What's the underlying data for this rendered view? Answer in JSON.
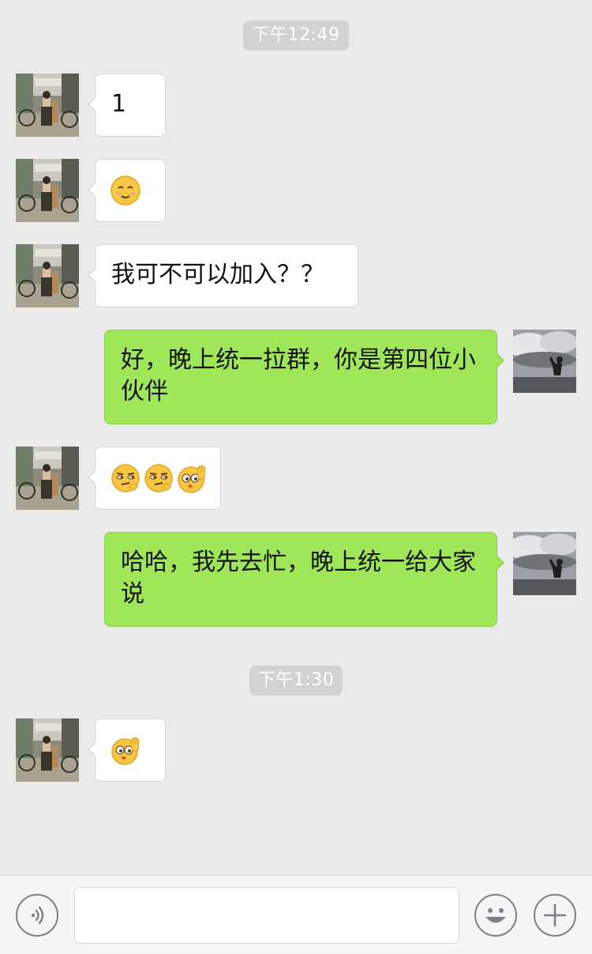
{
  "timestamps": [
    "下午12:49",
    "下午1:30"
  ],
  "messages": [
    {
      "side": "left",
      "text": "1"
    },
    {
      "side": "left",
      "emoji": [
        "smiling-face-emoji"
      ]
    },
    {
      "side": "left",
      "text": "我可不可以加入？？"
    },
    {
      "side": "right",
      "text": "好，晚上统一拉群，你是第四位小伙伴"
    },
    {
      "side": "left",
      "emoji": [
        "smirk-face-emoji",
        "smirk-face-emoji",
        "wave-face-emoji"
      ]
    },
    {
      "side": "right",
      "text": "哈哈，我先去忙，晚上统一给大家说"
    },
    {
      "side": "left",
      "emoji": [
        "wave-face-emoji"
      ]
    }
  ],
  "input": {
    "value": "",
    "voice_icon": "voice-icon",
    "emoji_icon": "emoji-icon",
    "plus_icon": "plus-icon"
  },
  "colors": {
    "background": "#ebebeb",
    "bubble_right": "#9fe658",
    "bubble_left": "#ffffff",
    "time_pill": "#d2d2d2"
  }
}
